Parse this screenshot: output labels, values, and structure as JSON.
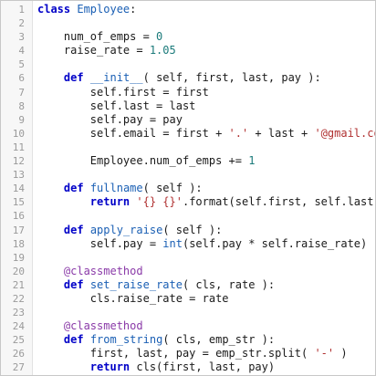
{
  "colors": {
    "keyword": "#0000c8",
    "function_name": "#1a5fb4",
    "string": "#b03030",
    "number": "#1a7a7a",
    "decorator": "#8a3aa8",
    "text": "#1a1a1a",
    "line_number": "#9a9a9a",
    "gutter_bg": "#f7f7f7"
  },
  "lines": [
    {
      "n": "1",
      "tokens": [
        {
          "t": "kw",
          "v": "class"
        },
        {
          "t": "txt",
          "v": " "
        },
        {
          "t": "fn",
          "v": "Employee"
        },
        {
          "t": "txt",
          "v": ":"
        }
      ]
    },
    {
      "n": "2",
      "tokens": []
    },
    {
      "n": "3",
      "tokens": [
        {
          "t": "txt",
          "v": "    num_of_emps = "
        },
        {
          "t": "num",
          "v": "0"
        }
      ]
    },
    {
      "n": "4",
      "tokens": [
        {
          "t": "txt",
          "v": "    raise_rate = "
        },
        {
          "t": "num",
          "v": "1.05"
        }
      ]
    },
    {
      "n": "5",
      "tokens": []
    },
    {
      "n": "6",
      "tokens": [
        {
          "t": "txt",
          "v": "    "
        },
        {
          "t": "kw",
          "v": "def"
        },
        {
          "t": "txt",
          "v": " "
        },
        {
          "t": "fn",
          "v": "__init__"
        },
        {
          "t": "txt",
          "v": "( self, first, last, pay ):"
        }
      ]
    },
    {
      "n": "7",
      "tokens": [
        {
          "t": "txt",
          "v": "        self.first = first"
        }
      ]
    },
    {
      "n": "8",
      "tokens": [
        {
          "t": "txt",
          "v": "        self.last = last"
        }
      ]
    },
    {
      "n": "9",
      "tokens": [
        {
          "t": "txt",
          "v": "        self.pay = pay"
        }
      ]
    },
    {
      "n": "10",
      "tokens": [
        {
          "t": "txt",
          "v": "        self.email = first + "
        },
        {
          "t": "str",
          "v": "'.'"
        },
        {
          "t": "txt",
          "v": " + last + "
        },
        {
          "t": "str",
          "v": "'@gmail.com'"
        }
      ]
    },
    {
      "n": "11",
      "tokens": []
    },
    {
      "n": "12",
      "tokens": [
        {
          "t": "txt",
          "v": "        Employee.num_of_emps += "
        },
        {
          "t": "num",
          "v": "1"
        }
      ]
    },
    {
      "n": "13",
      "tokens": []
    },
    {
      "n": "14",
      "tokens": [
        {
          "t": "txt",
          "v": "    "
        },
        {
          "t": "kw",
          "v": "def"
        },
        {
          "t": "txt",
          "v": " "
        },
        {
          "t": "fn",
          "v": "fullname"
        },
        {
          "t": "txt",
          "v": "( self ):"
        }
      ]
    },
    {
      "n": "15",
      "tokens": [
        {
          "t": "txt",
          "v": "        "
        },
        {
          "t": "kw",
          "v": "return"
        },
        {
          "t": "txt",
          "v": " "
        },
        {
          "t": "str",
          "v": "'{} {}'"
        },
        {
          "t": "txt",
          "v": ".format(self.first, self.last)"
        }
      ]
    },
    {
      "n": "16",
      "tokens": []
    },
    {
      "n": "17",
      "tokens": [
        {
          "t": "txt",
          "v": "    "
        },
        {
          "t": "kw",
          "v": "def"
        },
        {
          "t": "txt",
          "v": " "
        },
        {
          "t": "fn",
          "v": "apply_raise"
        },
        {
          "t": "txt",
          "v": "( self ):"
        }
      ]
    },
    {
      "n": "18",
      "tokens": [
        {
          "t": "txt",
          "v": "        self.pay = "
        },
        {
          "t": "fn",
          "v": "int"
        },
        {
          "t": "txt",
          "v": "(self.pay * self.raise_rate)"
        }
      ]
    },
    {
      "n": "19",
      "tokens": []
    },
    {
      "n": "20",
      "tokens": [
        {
          "t": "txt",
          "v": "    "
        },
        {
          "t": "deco",
          "v": "@classmethod"
        }
      ]
    },
    {
      "n": "21",
      "tokens": [
        {
          "t": "txt",
          "v": "    "
        },
        {
          "t": "kw",
          "v": "def"
        },
        {
          "t": "txt",
          "v": " "
        },
        {
          "t": "fn",
          "v": "set_raise_rate"
        },
        {
          "t": "txt",
          "v": "( cls, rate ):"
        }
      ]
    },
    {
      "n": "22",
      "tokens": [
        {
          "t": "txt",
          "v": "        cls.raise_rate = rate"
        }
      ]
    },
    {
      "n": "23",
      "tokens": []
    },
    {
      "n": "24",
      "tokens": [
        {
          "t": "txt",
          "v": "    "
        },
        {
          "t": "deco",
          "v": "@classmethod"
        }
      ]
    },
    {
      "n": "25",
      "tokens": [
        {
          "t": "txt",
          "v": "    "
        },
        {
          "t": "kw",
          "v": "def"
        },
        {
          "t": "txt",
          "v": " "
        },
        {
          "t": "fn",
          "v": "from_string"
        },
        {
          "t": "txt",
          "v": "( cls, emp_str ):"
        }
      ]
    },
    {
      "n": "26",
      "tokens": [
        {
          "t": "txt",
          "v": "        first, last, pay = emp_str.split( "
        },
        {
          "t": "str",
          "v": "'-'"
        },
        {
          "t": "txt",
          "v": " )"
        }
      ]
    },
    {
      "n": "27",
      "tokens": [
        {
          "t": "txt",
          "v": "        "
        },
        {
          "t": "kw",
          "v": "return"
        },
        {
          "t": "txt",
          "v": " cls(first, last, pay)"
        }
      ]
    }
  ]
}
